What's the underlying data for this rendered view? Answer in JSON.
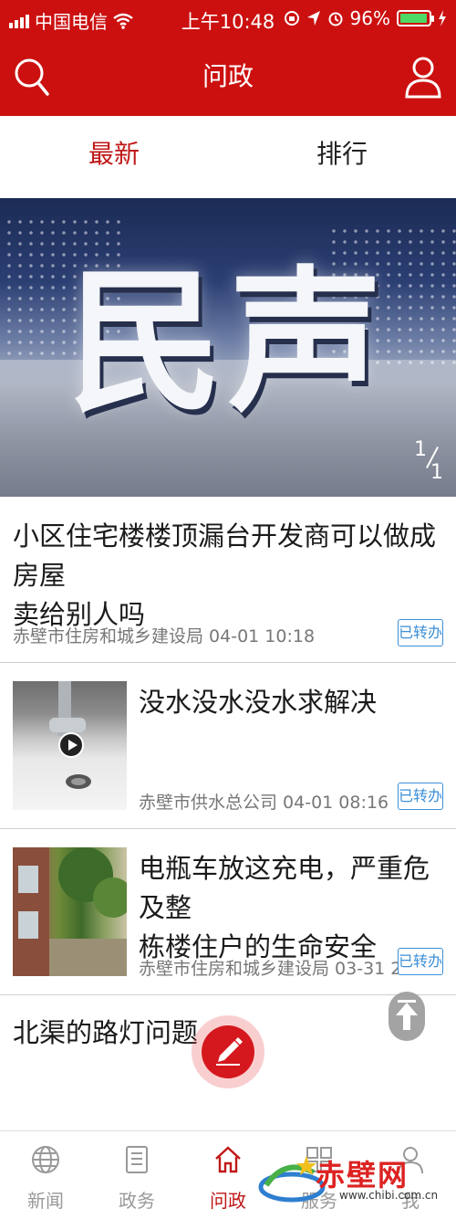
{
  "status_bar": {
    "carrier": "中国电信",
    "time": "上午10:48",
    "battery": "96%"
  },
  "header": {
    "title": "问政"
  },
  "tabs": [
    {
      "label": "最新"
    },
    {
      "label": "排行"
    }
  ],
  "banner": {
    "text": "民声",
    "pager_current": "1",
    "pager_total": "1"
  },
  "news": [
    {
      "title_line1": "小区住宅楼楼顶漏台开发商可以做成房屋",
      "title_line2": "卖给别人吗",
      "meta": "赤壁市住房和城乡建设局 04-01 10:18",
      "badge": "已转办"
    },
    {
      "title_line1": "没水没水没水求解决",
      "meta": "赤壁市供水总公司 04-01 08:16",
      "badge": "已转办"
    },
    {
      "title_line1": "电瓶车放这充电，严重危及整",
      "title_line2": "栋楼住户的生命安全",
      "meta": "赤壁市住房和城乡建设局 03-31 22:41",
      "badge": "已转办"
    },
    {
      "title_line1": "北渠的路灯问题"
    }
  ],
  "bottom_nav": [
    {
      "label": "新闻",
      "icon": "globe-icon"
    },
    {
      "label": "政务",
      "icon": "document-icon"
    },
    {
      "label": "问政",
      "icon": "home-icon"
    },
    {
      "label": "服务",
      "icon": "grid-icon"
    },
    {
      "label": "我",
      "icon": "person-icon"
    }
  ],
  "watermark": {
    "text": "赤壁网",
    "url": "www.chibi.com.cn"
  },
  "colors": {
    "brand": "#cc1010",
    "badge": "#3b8fd7"
  }
}
